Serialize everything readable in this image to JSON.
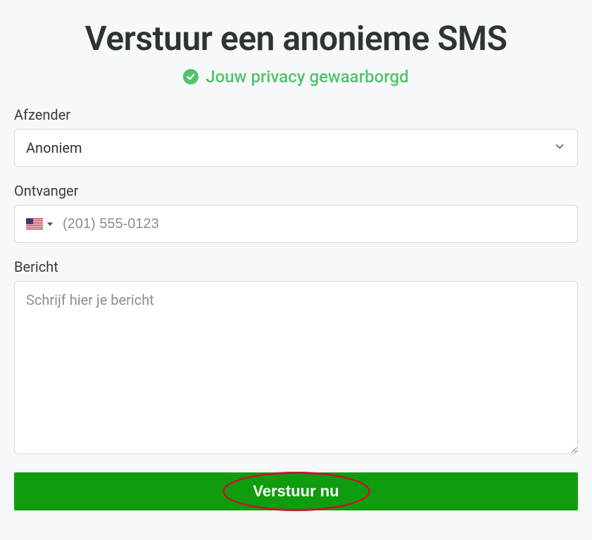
{
  "heading": "Verstuur een anonieme SMS",
  "privacy_text": "Jouw privacy gewaarborgd",
  "sender": {
    "label": "Afzender",
    "selected": "Anoniem"
  },
  "recipient": {
    "label": "Ontvanger",
    "placeholder": "(201) 555-0123",
    "country": "us"
  },
  "message": {
    "label": "Bericht",
    "placeholder": "Schrijf hier je bericht"
  },
  "submit_label": "Verstuur nu"
}
